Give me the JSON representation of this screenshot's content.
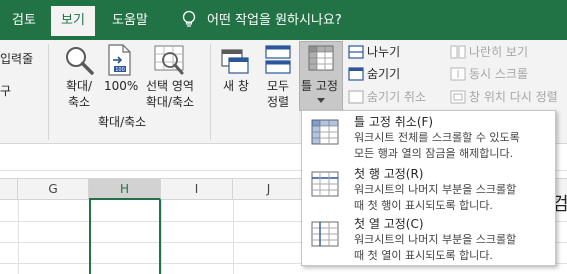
{
  "tabs": {
    "review": "검토",
    "view": "보기",
    "help": "도움말",
    "tell_me": "어떤 작업을 원하시나요?"
  },
  "ribbon": {
    "partial_label_top": "입력줄",
    "partial_label_bottom": "구",
    "zoom": "확대/\n축소",
    "zoom_line1": "확대/",
    "zoom_line2": "축소",
    "zoom100": "100%",
    "zoom_selection_line1": "선택 영역",
    "zoom_selection_line2": "확대/축소",
    "group_zoom": "확대/축소",
    "new_window_line1": "새 창",
    "arrange_all_line1": "모두",
    "arrange_all_line2": "정렬",
    "freeze_panes": "틀 고정",
    "split": "나누기",
    "hide": "숨기기",
    "unhide": "숨기기 취소",
    "view_side_by_side": "나란히 보기",
    "sync_scroll": "동시 스크롤",
    "reset_window_position": "창 위치 다시 정렬"
  },
  "columns": [
    "G",
    "H",
    "I",
    "J"
  ],
  "dropdown": {
    "items": [
      {
        "title": "틀 고정 취소(F)",
        "desc1": "워크시트 전체를 스크롤할 수 있도록",
        "desc2": "모든 행과 열의 잠금을 해제합니다."
      },
      {
        "title": "첫 행 고정(R)",
        "desc1": "워크시트의 나머지 부분을 스크롤할",
        "desc2": "때 첫 행이 표시되도록 합니다."
      },
      {
        "title": "첫 열 고정(C)",
        "desc1": "워크시트의 나머지 부분을 스크롤할",
        "desc2": "때 첫 열이 표시되도록 합니다."
      }
    ]
  },
  "right_edge_partial": "검",
  "colors": {
    "brand": "#217346",
    "ribbon_bg": "#f3f3f3",
    "accent_blue": "#2b579a"
  }
}
